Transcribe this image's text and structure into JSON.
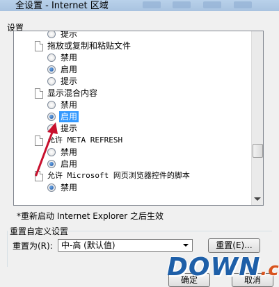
{
  "window": {
    "title": "全设置 - Internet 区域"
  },
  "settings": {
    "label": "设置",
    "rows": [
      {
        "kind": "option",
        "label": "提示",
        "checked": false
      },
      {
        "kind": "category",
        "label": "拖放或复制和粘贴文件"
      },
      {
        "kind": "option",
        "label": "禁用",
        "checked": false
      },
      {
        "kind": "option",
        "label": "启用",
        "checked": true
      },
      {
        "kind": "option",
        "label": "提示",
        "checked": false
      },
      {
        "kind": "category",
        "label": "显示混合内容"
      },
      {
        "kind": "option",
        "label": "禁用",
        "checked": false
      },
      {
        "kind": "option",
        "label": "启用",
        "checked": true,
        "selected": true
      },
      {
        "kind": "option",
        "label": "提示",
        "checked": false
      },
      {
        "kind": "category",
        "label": "允许 META REFRESH",
        "mono": true
      },
      {
        "kind": "option",
        "label": "禁用",
        "checked": false
      },
      {
        "kind": "option",
        "label": "启用",
        "checked": true
      },
      {
        "kind": "category",
        "label": "允许 Microsoft 网页浏览器控件的脚本",
        "mono": true
      },
      {
        "kind": "option",
        "label": "禁用",
        "checked": true
      }
    ]
  },
  "note": "*重新启动 Internet Explorer 之后生效",
  "reset_group": {
    "title": "重置自定义设置",
    "reset_to_label": "重置为(R):",
    "selected_level": "中-高 (默认值)",
    "reset_button": "重置(E)..."
  },
  "footer": {
    "ok": "确定",
    "cancel": "取消"
  },
  "watermark": {
    "main": "DOWN",
    "cc": ".cc"
  },
  "colors": {
    "selection": "#3399ff",
    "annotation_arrow": "#c8102e",
    "watermark_blue": "#1e5fa8",
    "watermark_orange": "#d8541f"
  }
}
